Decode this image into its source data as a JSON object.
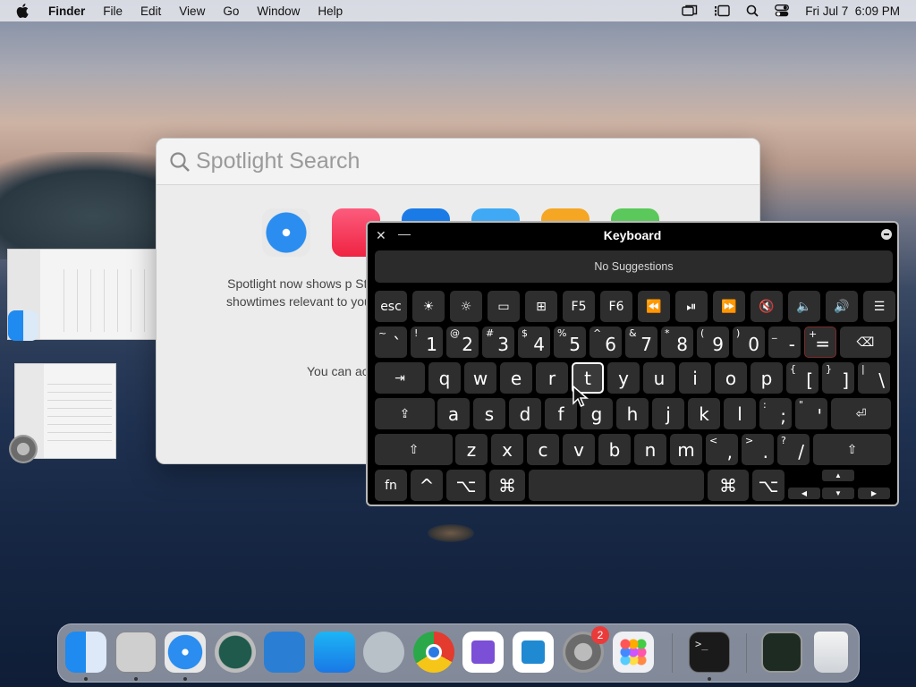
{
  "menubar": {
    "app_name": "Finder",
    "items": [
      "File",
      "Edit",
      "View",
      "Go",
      "Window",
      "Help"
    ],
    "clock": "Fri Jul 7  6:09 PM",
    "status_icons": [
      "screen-mirroring-icon",
      "stage-manager-icon",
      "search-icon",
      "control-center-icon"
    ]
  },
  "spotlight": {
    "placeholder": "Spotlight Search",
    "text1": "Spotlight now shows p Store, movie showtimes relevant to you, Spotlight",
    "text2": "You can ac"
  },
  "keyboard": {
    "title": "Keyboard",
    "suggestions": "No Suggestions",
    "rows": {
      "fn_row": [
        "esc",
        "☀",
        "☼",
        "▭",
        "⊞",
        "F5",
        "F6",
        "⏪",
        "⏯",
        "⏩",
        "🔇",
        "🔈",
        "🔊",
        "☰"
      ],
      "num_row": [
        [
          "~",
          "`"
        ],
        [
          "!",
          "1"
        ],
        [
          "@",
          "2"
        ],
        [
          "#",
          "3"
        ],
        [
          "$",
          "4"
        ],
        [
          "%",
          "5"
        ],
        [
          "^",
          "6"
        ],
        [
          "&",
          "7"
        ],
        [
          "*",
          "8"
        ],
        [
          "(",
          "9"
        ],
        [
          ")",
          "0"
        ],
        [
          "_",
          "-"
        ],
        [
          "+",
          "="
        ]
      ],
      "q_row": [
        "q",
        "w",
        "e",
        "r",
        "t",
        "y",
        "u",
        "i",
        "o",
        "p"
      ],
      "q_row_punct": [
        [
          "{",
          "["
        ],
        [
          "}",
          "]"
        ],
        [
          "|",
          "\\"
        ]
      ],
      "a_row": [
        "a",
        "s",
        "d",
        "f",
        "g",
        "h",
        "j",
        "k",
        "l"
      ],
      "a_row_punct": [
        [
          ":",
          ";"
        ],
        [
          "\"",
          "'"
        ]
      ],
      "z_row": [
        "z",
        "x",
        "c",
        "v",
        "b",
        "n",
        "m"
      ],
      "z_row_punct": [
        [
          "<",
          ","
        ],
        [
          ">",
          "."
        ],
        [
          "?",
          "/"
        ]
      ],
      "bottom": [
        "fn",
        "^",
        "⌥",
        "⌘",
        "",
        "⌘",
        "⌥"
      ]
    }
  },
  "dock": {
    "apps": [
      "Finder",
      "Script Editor",
      "Safari",
      "Time Machine",
      "Xcode Instruments",
      "App Store",
      "Automator",
      "Google Chrome",
      "Visual Studio",
      "Visual Studio Code",
      "System Settings",
      "Launchpad",
      "Terminal",
      "Activity Monitor",
      "Trash"
    ],
    "system_settings_badge": "2"
  }
}
